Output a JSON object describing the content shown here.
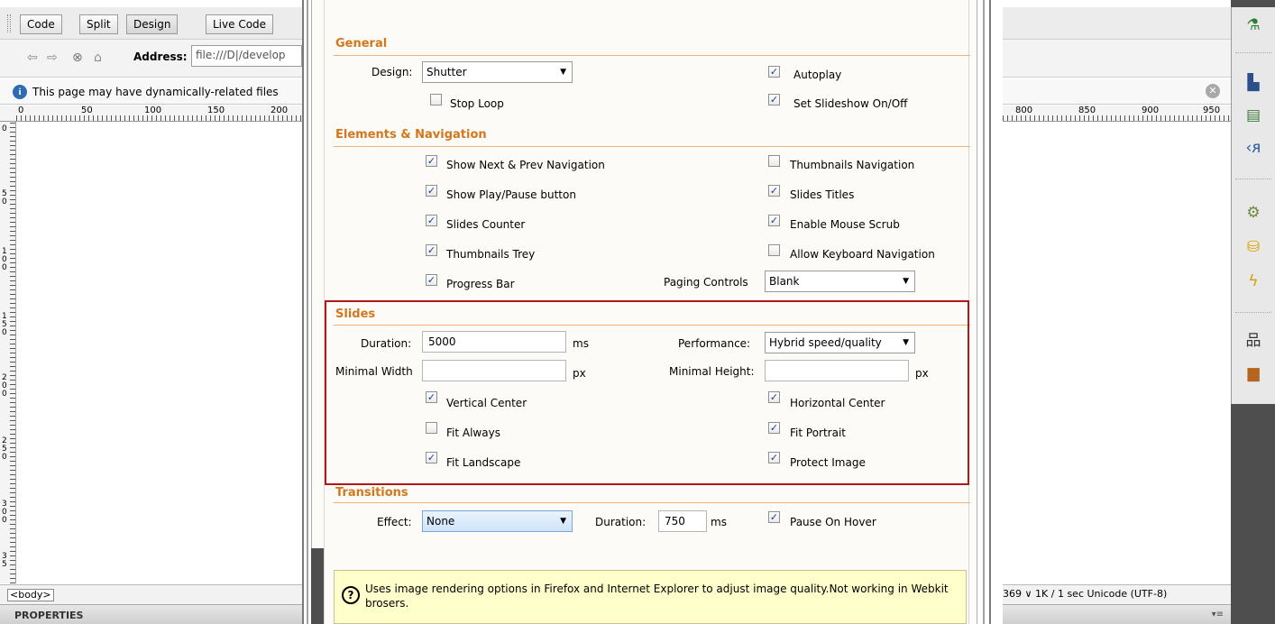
{
  "left_toolbar": {
    "buttons": [
      "Code",
      "Split",
      "Design",
      "Live Code"
    ],
    "address_label": "Address:",
    "address_value": "file:///D|/develop",
    "info_text": "This page may have dynamically-related files",
    "ruler_labels": [
      "0",
      "50",
      "100",
      "150",
      "200"
    ],
    "vruler_labels": [
      "0",
      "50",
      "100",
      "150",
      "200",
      "250",
      "300",
      "35"
    ],
    "tag_selector": "<body>",
    "properties_label": "PROPERTIES"
  },
  "right_area": {
    "ruler_labels": [
      "800",
      "850",
      "900",
      "950"
    ],
    "status_text": "369 ∨  1K / 1 sec  Unicode (UTF-8)"
  },
  "dialog": {
    "general": {
      "heading": "General",
      "design_label": "Design:",
      "design_value": "Shutter",
      "autoplay": "Autoplay",
      "stop_loop": "Stop Loop",
      "slideshow_onoff": "Set Slideshow On/Off"
    },
    "elements": {
      "heading": "Elements & Navigation",
      "show_next_prev": "Show Next & Prev Navigation",
      "thumbnails_nav": "Thumbnails Navigation",
      "show_play_pause": "Show Play/Pause button",
      "slides_titles": "Slides Titles",
      "slides_counter": "Slides Counter",
      "enable_mouse_scrub": "Enable Mouse Scrub",
      "thumbnails_trey": "Thumbnails Trey",
      "allow_keyboard": "Allow Keyboard Navigation",
      "progress_bar": "Progress Bar",
      "paging_label": "Paging Controls",
      "paging_value": "Blank"
    },
    "slides": {
      "heading": "Slides",
      "duration_label": "Duration:",
      "duration_value": "5000",
      "duration_unit": "ms",
      "performance_label": "Performance:",
      "performance_value": "Hybrid speed/quality",
      "min_width_label": "Minimal Width",
      "min_width_unit": "px",
      "min_height_label": "Minimal Height:",
      "min_height_unit": "px",
      "vertical_center": "Vertical Center",
      "horizontal_center": "Horizontal Center",
      "fit_always": "Fit Always",
      "fit_portrait": "Fit Portrait",
      "fit_landscape": "Fit Landscape",
      "protect_image": "Protect Image"
    },
    "transitions": {
      "heading": "Transitions",
      "effect_label": "Effect:",
      "effect_value": "None",
      "duration_label": "Duration:",
      "duration_value": "750",
      "duration_unit": "ms",
      "pause_on_hover": "Pause On Hover"
    },
    "help_text": "Uses image rendering options in Firefox and Internet Explorer to adjust image quality.Not working in Webkit brosers."
  },
  "checkbox_states": {
    "autoplay": true,
    "stop_loop": false,
    "slideshow_onoff": true,
    "show_next_prev": true,
    "thumbnails_nav": false,
    "show_play_pause": true,
    "slides_titles": true,
    "slides_counter": true,
    "enable_mouse_scrub": true,
    "thumbnails_trey": true,
    "allow_keyboard": false,
    "progress_bar": true,
    "vertical_center": true,
    "horizontal_center": true,
    "fit_always": false,
    "fit_portrait": true,
    "fit_landscape": true,
    "protect_image": true,
    "pause_on_hover": true
  },
  "colors": {
    "section_heading": "#d4771c",
    "highlight_border": "#b01818",
    "help_background": "#ffffcc"
  }
}
